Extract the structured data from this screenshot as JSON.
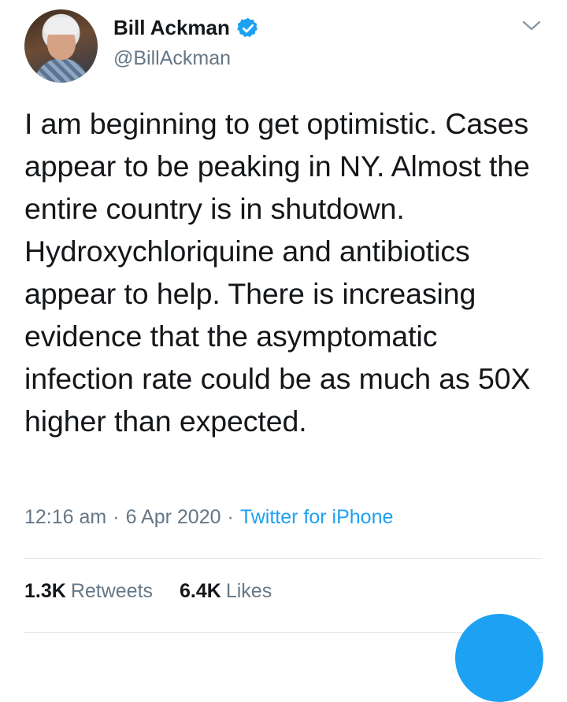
{
  "author": {
    "display_name": "Bill Ackman",
    "handle": "@BillAckman",
    "verified": true
  },
  "tweet": {
    "text": "I am beginning to get optimistic. Cases appear to be peaking in NY. Almost the entire country is in shutdown. Hydroxychloriquine and antibiotics appear to help. There is increasing evidence that the asymptomatic infection rate could be as much as 50X higher than expected.",
    "time": "12:16 am",
    "separator": "·",
    "date": "6 Apr 2020",
    "source": "Twitter for iPhone"
  },
  "stats": {
    "retweets_count": "1.3K",
    "retweets_label": "Retweets",
    "likes_count": "6.4K",
    "likes_label": "Likes"
  },
  "colors": {
    "accent": "#1da1f2",
    "secondary_text": "#657786",
    "divider": "#e1e8ed"
  },
  "icons": {
    "verified": "verified-badge-icon",
    "menu": "chevron-down-icon"
  }
}
